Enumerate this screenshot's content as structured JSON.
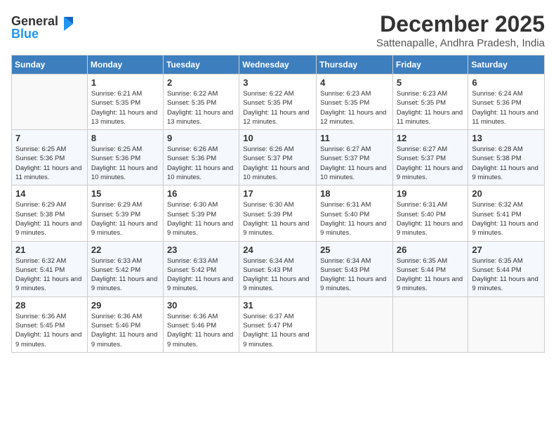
{
  "logo": {
    "general": "General",
    "blue": "Blue"
  },
  "title": "December 2025",
  "location": "Sattenapalle, Andhra Pradesh, India",
  "days_of_week": [
    "Sunday",
    "Monday",
    "Tuesday",
    "Wednesday",
    "Thursday",
    "Friday",
    "Saturday"
  ],
  "weeks": [
    [
      {
        "day": "",
        "sunrise": "",
        "sunset": "",
        "daylight": ""
      },
      {
        "day": "1",
        "sunrise": "Sunrise: 6:21 AM",
        "sunset": "Sunset: 5:35 PM",
        "daylight": "Daylight: 11 hours and 13 minutes."
      },
      {
        "day": "2",
        "sunrise": "Sunrise: 6:22 AM",
        "sunset": "Sunset: 5:35 PM",
        "daylight": "Daylight: 11 hours and 13 minutes."
      },
      {
        "day": "3",
        "sunrise": "Sunrise: 6:22 AM",
        "sunset": "Sunset: 5:35 PM",
        "daylight": "Daylight: 11 hours and 12 minutes."
      },
      {
        "day": "4",
        "sunrise": "Sunrise: 6:23 AM",
        "sunset": "Sunset: 5:35 PM",
        "daylight": "Daylight: 11 hours and 12 minutes."
      },
      {
        "day": "5",
        "sunrise": "Sunrise: 6:23 AM",
        "sunset": "Sunset: 5:35 PM",
        "daylight": "Daylight: 11 hours and 11 minutes."
      },
      {
        "day": "6",
        "sunrise": "Sunrise: 6:24 AM",
        "sunset": "Sunset: 5:36 PM",
        "daylight": "Daylight: 11 hours and 11 minutes."
      }
    ],
    [
      {
        "day": "7",
        "sunrise": "Sunrise: 6:25 AM",
        "sunset": "Sunset: 5:36 PM",
        "daylight": "Daylight: 11 hours and 11 minutes."
      },
      {
        "day": "8",
        "sunrise": "Sunrise: 6:25 AM",
        "sunset": "Sunset: 5:36 PM",
        "daylight": "Daylight: 11 hours and 10 minutes."
      },
      {
        "day": "9",
        "sunrise": "Sunrise: 6:26 AM",
        "sunset": "Sunset: 5:36 PM",
        "daylight": "Daylight: 11 hours and 10 minutes."
      },
      {
        "day": "10",
        "sunrise": "Sunrise: 6:26 AM",
        "sunset": "Sunset: 5:37 PM",
        "daylight": "Daylight: 11 hours and 10 minutes."
      },
      {
        "day": "11",
        "sunrise": "Sunrise: 6:27 AM",
        "sunset": "Sunset: 5:37 PM",
        "daylight": "Daylight: 11 hours and 10 minutes."
      },
      {
        "day": "12",
        "sunrise": "Sunrise: 6:27 AM",
        "sunset": "Sunset: 5:37 PM",
        "daylight": "Daylight: 11 hours and 9 minutes."
      },
      {
        "day": "13",
        "sunrise": "Sunrise: 6:28 AM",
        "sunset": "Sunset: 5:38 PM",
        "daylight": "Daylight: 11 hours and 9 minutes."
      }
    ],
    [
      {
        "day": "14",
        "sunrise": "Sunrise: 6:29 AM",
        "sunset": "Sunset: 5:38 PM",
        "daylight": "Daylight: 11 hours and 9 minutes."
      },
      {
        "day": "15",
        "sunrise": "Sunrise: 6:29 AM",
        "sunset": "Sunset: 5:39 PM",
        "daylight": "Daylight: 11 hours and 9 minutes."
      },
      {
        "day": "16",
        "sunrise": "Sunrise: 6:30 AM",
        "sunset": "Sunset: 5:39 PM",
        "daylight": "Daylight: 11 hours and 9 minutes."
      },
      {
        "day": "17",
        "sunrise": "Sunrise: 6:30 AM",
        "sunset": "Sunset: 5:39 PM",
        "daylight": "Daylight: 11 hours and 9 minutes."
      },
      {
        "day": "18",
        "sunrise": "Sunrise: 6:31 AM",
        "sunset": "Sunset: 5:40 PM",
        "daylight": "Daylight: 11 hours and 9 minutes."
      },
      {
        "day": "19",
        "sunrise": "Sunrise: 6:31 AM",
        "sunset": "Sunset: 5:40 PM",
        "daylight": "Daylight: 11 hours and 9 minutes."
      },
      {
        "day": "20",
        "sunrise": "Sunrise: 6:32 AM",
        "sunset": "Sunset: 5:41 PM",
        "daylight": "Daylight: 11 hours and 9 minutes."
      }
    ],
    [
      {
        "day": "21",
        "sunrise": "Sunrise: 6:32 AM",
        "sunset": "Sunset: 5:41 PM",
        "daylight": "Daylight: 11 hours and 9 minutes."
      },
      {
        "day": "22",
        "sunrise": "Sunrise: 6:33 AM",
        "sunset": "Sunset: 5:42 PM",
        "daylight": "Daylight: 11 hours and 9 minutes."
      },
      {
        "day": "23",
        "sunrise": "Sunrise: 6:33 AM",
        "sunset": "Sunset: 5:42 PM",
        "daylight": "Daylight: 11 hours and 9 minutes."
      },
      {
        "day": "24",
        "sunrise": "Sunrise: 6:34 AM",
        "sunset": "Sunset: 5:43 PM",
        "daylight": "Daylight: 11 hours and 9 minutes."
      },
      {
        "day": "25",
        "sunrise": "Sunrise: 6:34 AM",
        "sunset": "Sunset: 5:43 PM",
        "daylight": "Daylight: 11 hours and 9 minutes."
      },
      {
        "day": "26",
        "sunrise": "Sunrise: 6:35 AM",
        "sunset": "Sunset: 5:44 PM",
        "daylight": "Daylight: 11 hours and 9 minutes."
      },
      {
        "day": "27",
        "sunrise": "Sunrise: 6:35 AM",
        "sunset": "Sunset: 5:44 PM",
        "daylight": "Daylight: 11 hours and 9 minutes."
      }
    ],
    [
      {
        "day": "28",
        "sunrise": "Sunrise: 6:36 AM",
        "sunset": "Sunset: 5:45 PM",
        "daylight": "Daylight: 11 hours and 9 minutes."
      },
      {
        "day": "29",
        "sunrise": "Sunrise: 6:36 AM",
        "sunset": "Sunset: 5:46 PM",
        "daylight": "Daylight: 11 hours and 9 minutes."
      },
      {
        "day": "30",
        "sunrise": "Sunrise: 6:36 AM",
        "sunset": "Sunset: 5:46 PM",
        "daylight": "Daylight: 11 hours and 9 minutes."
      },
      {
        "day": "31",
        "sunrise": "Sunrise: 6:37 AM",
        "sunset": "Sunset: 5:47 PM",
        "daylight": "Daylight: 11 hours and 9 minutes."
      },
      {
        "day": "",
        "sunrise": "",
        "sunset": "",
        "daylight": ""
      },
      {
        "day": "",
        "sunrise": "",
        "sunset": "",
        "daylight": ""
      },
      {
        "day": "",
        "sunrise": "",
        "sunset": "",
        "daylight": ""
      }
    ]
  ]
}
